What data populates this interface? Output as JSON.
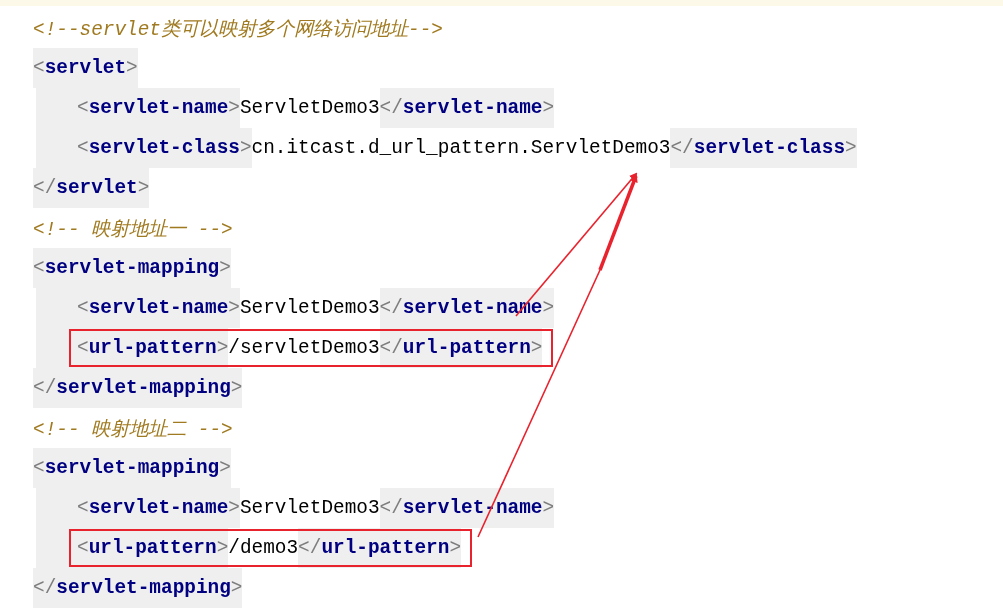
{
  "editor": {
    "lines": [
      {
        "kind": "comment",
        "text": "<!--servlet类可以映射多个网络访问地址-->"
      },
      {
        "kind": "element",
        "open": "<servlet>",
        "close": "</servlet>",
        "children": [
          {
            "open": "<servlet-name>",
            "value": "ServletDemo3",
            "close": "</servlet-name>",
            "boxed": false
          },
          {
            "open": "<servlet-class>",
            "value": "cn.itcast.d_url_pattern.ServletDemo3",
            "close": "</servlet-class>",
            "boxed": false
          }
        ]
      },
      {
        "kind": "comment",
        "text": "<!-- 映射地址一 -->"
      },
      {
        "kind": "element",
        "open": "<servlet-mapping>",
        "close": "</servlet-mapping>",
        "children": [
          {
            "open": "<servlet-name>",
            "value": "ServletDemo3",
            "close": "</servlet-name>",
            "boxed": false
          },
          {
            "open": "<url-pattern>",
            "value": "/servletDemo3",
            "close": "</url-pattern>",
            "boxed": true
          }
        ]
      },
      {
        "kind": "comment",
        "text": "<!-- 映射地址二 -->"
      },
      {
        "kind": "element",
        "open": "<servlet-mapping>",
        "close": "</servlet-mapping>",
        "children": [
          {
            "open": "<servlet-name>",
            "value": "ServletDemo3",
            "close": "</servlet-name>",
            "boxed": false
          },
          {
            "open": "<url-pattern>",
            "value": "/demo3",
            "close": "</url-pattern>",
            "boxed": true
          }
        ]
      }
    ]
  }
}
